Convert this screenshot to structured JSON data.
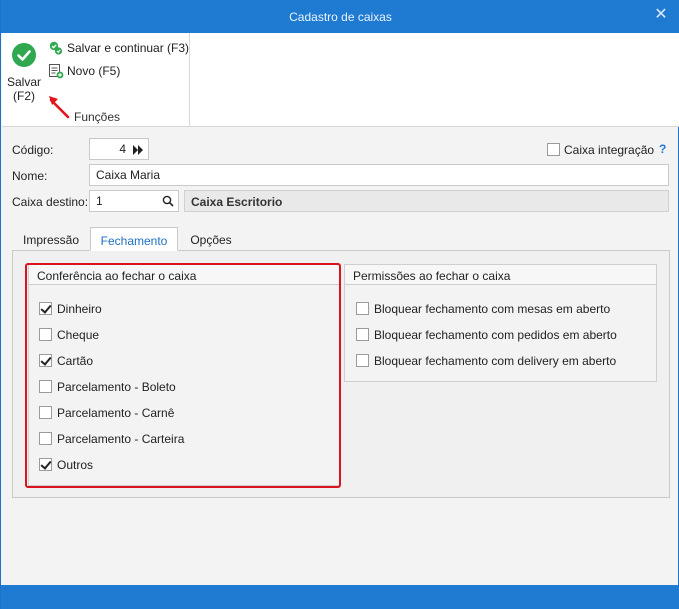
{
  "window": {
    "title": "Cadastro de caixas",
    "close_glyph": "✕"
  },
  "ribbon": {
    "save_label": "Salvar\n(F2)",
    "save_continue_label": "Salvar e continuar (F3)",
    "new_label": "Novo (F5)",
    "group_caption": "Funções",
    "icons": {
      "save": "check-circle-icon",
      "save_continue": "save-continue-icon",
      "new": "new-document-icon"
    },
    "colors": {
      "save_green": "#2fa84f",
      "accent": "#1f7ad1"
    }
  },
  "form": {
    "codigo_label": "Código:",
    "codigo_value": "4",
    "nome_label": "Nome:",
    "nome_value": "Caixa Maria",
    "destino_label": "Caixa destino:",
    "destino_value": "1",
    "destino_description": "Caixa Escritorio",
    "integracao_label": "Caixa integração",
    "integracao_checked": false,
    "help_glyph": "?"
  },
  "tabs": [
    {
      "label": "Impressão",
      "active": false
    },
    {
      "label": "Fechamento",
      "active": true
    },
    {
      "label": "Opções",
      "active": false
    }
  ],
  "conferencia": {
    "title": "Conferência ao fechar o caixa",
    "items": [
      {
        "label": "Dinheiro",
        "checked": true
      },
      {
        "label": "Cheque",
        "checked": false
      },
      {
        "label": "Cartão",
        "checked": true
      },
      {
        "label": "Parcelamento - Boleto",
        "checked": false
      },
      {
        "label": "Parcelamento - Carnê",
        "checked": false
      },
      {
        "label": "Parcelamento - Carteira",
        "checked": false
      },
      {
        "label": "Outros",
        "checked": true
      }
    ]
  },
  "permissoes": {
    "title": "Permissões ao fechar o caixa",
    "items": [
      {
        "label": "Bloquear fechamento com mesas em aberto",
        "checked": false
      },
      {
        "label": "Bloquear fechamento com pedidos em aberto",
        "checked": false
      },
      {
        "label": "Bloquear fechamento com delivery em aberto",
        "checked": false
      }
    ]
  }
}
